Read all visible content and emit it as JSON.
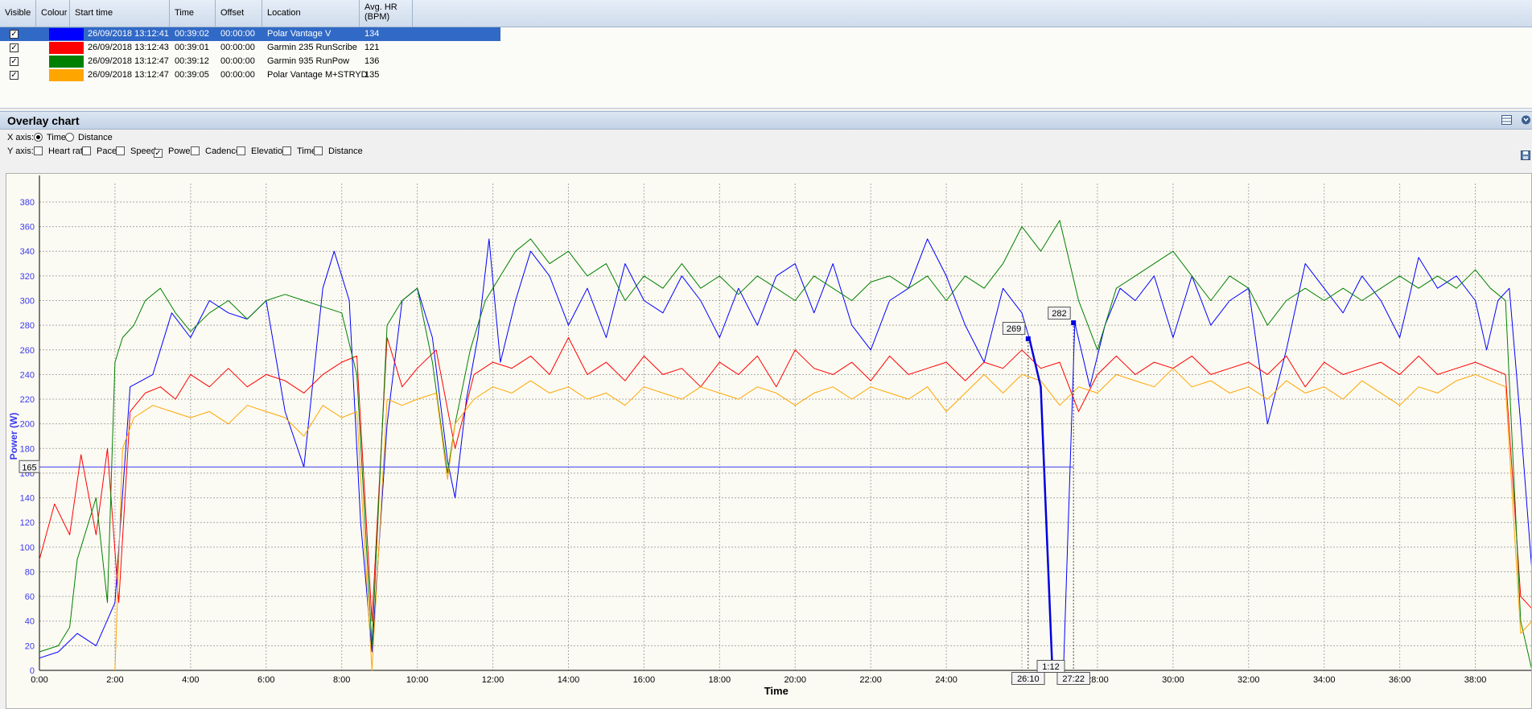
{
  "grid": {
    "headers": {
      "visible": "Visible",
      "colour": "Colour",
      "start_time": "Start time",
      "time": "Time",
      "offset": "Offset",
      "location": "Location",
      "avg_hr_line1": "Avg. HR",
      "avg_hr_line2": "(BPM)"
    },
    "rows": [
      {
        "visible": true,
        "colour": "#0000ff",
        "start_time": "26/09/2018 13:12:41",
        "time": "00:39:02",
        "offset": "00:00:00",
        "location": "Polar Vantage V",
        "avg_hr": "134",
        "selected": true
      },
      {
        "visible": true,
        "colour": "#ff0000",
        "start_time": "26/09/2018 13:12:43",
        "time": "00:39:01",
        "offset": "00:00:00",
        "location": "Garmin 235 RunScribe",
        "avg_hr": "121",
        "selected": false
      },
      {
        "visible": true,
        "colour": "#008000",
        "start_time": "26/09/2018 13:12:47",
        "time": "00:39:12",
        "offset": "00:00:00",
        "location": "Garmin 935 RunPow",
        "avg_hr": "136",
        "selected": false
      },
      {
        "visible": true,
        "colour": "#ffa500",
        "start_time": "26/09/2018 13:12:47",
        "time": "00:39:05",
        "offset": "00:00:00",
        "location": "Polar Vantage M+STRYD",
        "avg_hr": "135",
        "selected": false
      }
    ]
  },
  "overlay": {
    "title": "Overlay chart",
    "x_axis_label": "X axis:",
    "x_options": [
      {
        "label": "Time",
        "selected": true
      },
      {
        "label": "Distance",
        "selected": false
      }
    ],
    "y_axis_label": "Y axis:",
    "y_options": [
      {
        "label": "Heart rate",
        "checked": false
      },
      {
        "label": "Pace",
        "checked": false
      },
      {
        "label": "Speed",
        "checked": false
      },
      {
        "label": "Power",
        "checked": true
      },
      {
        "label": "Cadence",
        "checked": false
      },
      {
        "label": "Elevation",
        "checked": false
      },
      {
        "label": "Time",
        "checked": false
      },
      {
        "label": "Distance",
        "checked": false
      }
    ]
  },
  "chart_data": {
    "type": "line",
    "xlabel": "Time",
    "ylabel": "Power (W)",
    "xlim": [
      0,
      39.5
    ],
    "ylim": [
      0,
      395
    ],
    "x_ticks": [
      0,
      2,
      4,
      6,
      8,
      10,
      12,
      14,
      16,
      18,
      20,
      22,
      24,
      26,
      28,
      30,
      32,
      34,
      36,
      38
    ],
    "x_tick_labels": [
      "0:00",
      "2:00",
      "4:00",
      "6:00",
      "8:00",
      "10:00",
      "12:00",
      "14:00",
      "16:00",
      "18:00",
      "20:00",
      "22:00",
      "24:00",
      "26:00",
      "28:00",
      "30:00",
      "32:00",
      "34:00",
      "36:00",
      "38:00"
    ],
    "y_ticks": [
      0,
      20,
      40,
      60,
      80,
      100,
      120,
      140,
      160,
      180,
      200,
      220,
      240,
      260,
      280,
      300,
      320,
      340,
      360,
      380
    ],
    "grid": true,
    "cursor_value": "165",
    "selection": {
      "start": "26:10",
      "end": "27:22",
      "duration": "1:12",
      "start_value": "269",
      "end_value": "282"
    },
    "series": [
      {
        "color": "#0000ff",
        "x": [
          0,
          0.5,
          1,
          1.5,
          2,
          2.4,
          3,
          3.5,
          4,
          4.5,
          5,
          5.5,
          6,
          6.5,
          7,
          7.5,
          7.8,
          8.2,
          8.5,
          8.8,
          9.2,
          9.6,
          10,
          10.4,
          10.8,
          11,
          11.3,
          11.6,
          11.9,
          12.2,
          12.6,
          13,
          13.5,
          14,
          14.5,
          15,
          15.5,
          16,
          16.5,
          17,
          17.5,
          18,
          18.5,
          19,
          19.5,
          20,
          20.5,
          21,
          21.5,
          22,
          22.5,
          23,
          23.5,
          24,
          24.5,
          25,
          25.5,
          26,
          26.2,
          26.5,
          26.8,
          27.1,
          27.4,
          27.8,
          28.2,
          28.6,
          29,
          29.5,
          30,
          30.5,
          31,
          31.5,
          32,
          32.5,
          33,
          33.5,
          34,
          34.5,
          35,
          35.5,
          36,
          36.5,
          37,
          37.5,
          38,
          38.3,
          38.6,
          38.9,
          39.2,
          39.5
        ],
        "values": [
          10,
          15,
          30,
          20,
          55,
          230,
          240,
          290,
          270,
          300,
          290,
          285,
          300,
          210,
          165,
          310,
          340,
          300,
          120,
          15,
          200,
          300,
          310,
          270,
          170,
          140,
          220,
          270,
          350,
          250,
          300,
          340,
          320,
          280,
          310,
          270,
          330,
          300,
          290,
          320,
          300,
          270,
          310,
          280,
          320,
          330,
          290,
          330,
          280,
          260,
          300,
          310,
          350,
          320,
          280,
          250,
          310,
          290,
          269,
          230,
          5,
          0,
          282,
          230,
          280,
          310,
          300,
          320,
          270,
          320,
          280,
          300,
          310,
          200,
          260,
          330,
          310,
          290,
          320,
          300,
          270,
          335,
          310,
          320,
          300,
          260,
          300,
          310,
          200,
          80
        ]
      },
      {
        "color": "#ff0000",
        "x": [
          0,
          0.4,
          0.8,
          1.1,
          1.5,
          1.8,
          2.1,
          2.4,
          2.8,
          3.2,
          3.6,
          4,
          4.5,
          5,
          5.5,
          6,
          6.5,
          7,
          7.5,
          8,
          8.4,
          8.8,
          9.2,
          9.6,
          10,
          10.5,
          11,
          11.5,
          12,
          12.5,
          13,
          13.5,
          14,
          14.5,
          15,
          15.5,
          16,
          16.5,
          17,
          17.5,
          18,
          18.5,
          19,
          19.5,
          20,
          20.5,
          21,
          21.5,
          22,
          22.5,
          23,
          23.5,
          24,
          24.5,
          25,
          25.5,
          26,
          26.5,
          27,
          27.5,
          28,
          28.5,
          29,
          29.5,
          30,
          30.5,
          31,
          31.5,
          32,
          32.5,
          33,
          33.5,
          34,
          34.5,
          35,
          35.5,
          36,
          36.5,
          37,
          37.5,
          38,
          38.4,
          38.8,
          39.2,
          39.5
        ],
        "values": [
          90,
          135,
          110,
          175,
          110,
          180,
          55,
          210,
          225,
          230,
          220,
          240,
          230,
          245,
          230,
          240,
          235,
          225,
          240,
          250,
          255,
          40,
          270,
          230,
          245,
          260,
          180,
          240,
          250,
          245,
          255,
          240,
          270,
          240,
          250,
          235,
          255,
          240,
          245,
          230,
          250,
          240,
          255,
          230,
          260,
          245,
          240,
          250,
          235,
          255,
          240,
          245,
          250,
          235,
          250,
          245,
          260,
          245,
          250,
          210,
          240,
          255,
          240,
          250,
          245,
          255,
          240,
          245,
          250,
          240,
          255,
          230,
          250,
          240,
          245,
          250,
          240,
          255,
          240,
          245,
          250,
          245,
          240,
          60,
          50
        ]
      },
      {
        "color": "#008000",
        "x": [
          0,
          0.5,
          0.8,
          1,
          1.5,
          1.8,
          2,
          2.2,
          2.5,
          2.8,
          3.2,
          3.6,
          4,
          4.5,
          5,
          5.5,
          6,
          6.5,
          7,
          7.5,
          8,
          8.4,
          8.8,
          9.2,
          9.6,
          10,
          10.4,
          10.8,
          11,
          11.4,
          11.8,
          12.2,
          12.6,
          13,
          13.5,
          14,
          14.5,
          15,
          15.5,
          16,
          16.5,
          17,
          17.5,
          18,
          18.5,
          19,
          19.5,
          20,
          20.5,
          21,
          21.5,
          22,
          22.5,
          23,
          23.5,
          24,
          24.5,
          25,
          25.5,
          26,
          26.5,
          27,
          27.5,
          28,
          28.5,
          29,
          29.5,
          30,
          30.5,
          31,
          31.5,
          32,
          32.5,
          33,
          33.5,
          34,
          34.5,
          35,
          35.5,
          36,
          36.5,
          37,
          37.5,
          38,
          38.4,
          38.8,
          39.2,
          39.5
        ],
        "values": [
          15,
          20,
          35,
          90,
          140,
          55,
          250,
          270,
          280,
          300,
          310,
          290,
          275,
          290,
          300,
          285,
          300,
          305,
          300,
          295,
          290,
          240,
          20,
          280,
          300,
          310,
          250,
          160,
          200,
          260,
          300,
          320,
          340,
          350,
          330,
          340,
          320,
          330,
          300,
          320,
          310,
          330,
          310,
          320,
          305,
          320,
          310,
          300,
          320,
          310,
          300,
          315,
          320,
          310,
          320,
          300,
          320,
          310,
          330,
          360,
          340,
          365,
          300,
          260,
          310,
          320,
          330,
          340,
          320,
          300,
          320,
          310,
          280,
          300,
          310,
          300,
          310,
          300,
          310,
          320,
          310,
          320,
          310,
          325,
          310,
          300,
          40,
          0
        ]
      },
      {
        "color": "#ffa500",
        "x": [
          2,
          2.2,
          2.5,
          3,
          3.5,
          4,
          4.5,
          5,
          5.5,
          6,
          6.5,
          7,
          7.5,
          8,
          8.4,
          8.8,
          9.2,
          9.6,
          10,
          10.5,
          10.8,
          11,
          11.5,
          12,
          12.5,
          13,
          13.5,
          14,
          14.5,
          15,
          15.5,
          16,
          16.5,
          17,
          17.5,
          18,
          18.5,
          19,
          19.5,
          20,
          20.5,
          21,
          21.5,
          22,
          22.5,
          23,
          23.5,
          24,
          24.5,
          25,
          25.5,
          26,
          26.5,
          27,
          27.5,
          28,
          28.5,
          29,
          29.5,
          30,
          30.5,
          31,
          31.5,
          32,
          32.5,
          33,
          33.5,
          34,
          34.5,
          35,
          35.5,
          36,
          36.5,
          37,
          37.5,
          38,
          38.4,
          38.8,
          39.2,
          39.5
        ],
        "values": [
          0,
          180,
          205,
          215,
          210,
          205,
          210,
          200,
          215,
          210,
          205,
          190,
          215,
          205,
          210,
          0,
          220,
          215,
          220,
          225,
          155,
          200,
          220,
          230,
          225,
          235,
          225,
          230,
          220,
          225,
          215,
          230,
          225,
          220,
          230,
          225,
          220,
          230,
          225,
          215,
          225,
          230,
          220,
          230,
          225,
          220,
          230,
          210,
          225,
          240,
          225,
          240,
          235,
          215,
          230,
          225,
          240,
          235,
          230,
          245,
          230,
          235,
          225,
          230,
          220,
          235,
          225,
          230,
          220,
          235,
          225,
          215,
          230,
          225,
          235,
          240,
          235,
          230,
          30,
          40
        ]
      }
    ]
  }
}
